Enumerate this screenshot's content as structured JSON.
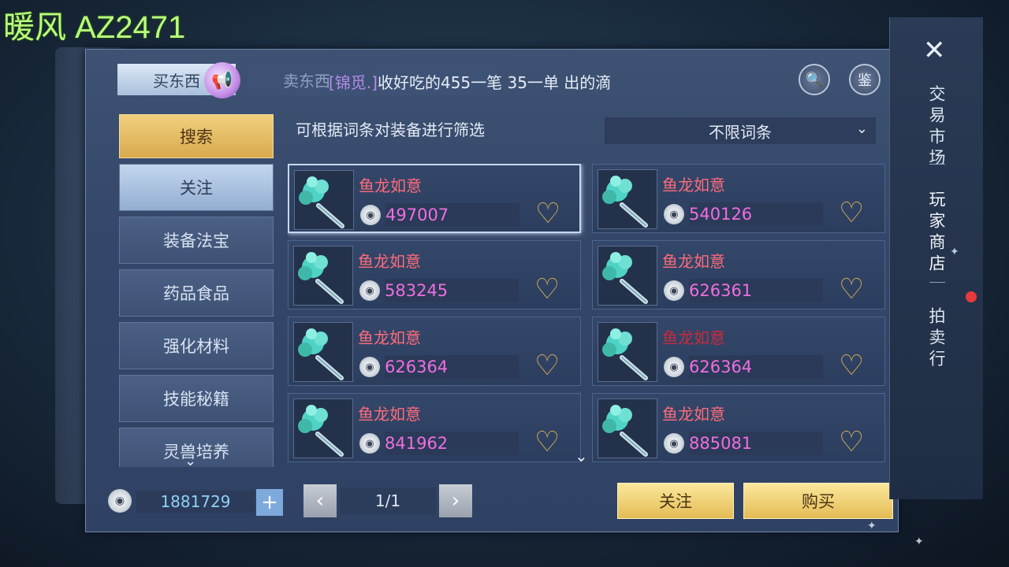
{
  "watermark": "暖风 AZ2471",
  "tabs": {
    "buy": "买东西",
    "sell": "卖东西"
  },
  "ticker": {
    "tag": "[锦觅.]",
    "message": "收好吃的455一笔  35一单 出的滴"
  },
  "header_buttons": {
    "search_icon": "magnifier-icon",
    "appraise_label": "鉴"
  },
  "sidebar": {
    "items": [
      {
        "label": "搜索",
        "state": "active"
      },
      {
        "label": "关注",
        "state": "follow"
      },
      {
        "label": "装备法宝",
        "state": "normal"
      },
      {
        "label": "药品食品",
        "state": "normal"
      },
      {
        "label": "强化材料",
        "state": "normal"
      },
      {
        "label": "技能秘籍",
        "state": "normal"
      },
      {
        "label": "灵兽培养",
        "state": "normal"
      }
    ]
  },
  "filter": {
    "label": "可根据词条对装备进行筛选",
    "dropdown_value": "不限词条"
  },
  "listings": [
    {
      "name": "鱼龙如意",
      "price": "497007",
      "selected": true
    },
    {
      "name": "鱼龙如意",
      "price": "540126",
      "selected": false
    },
    {
      "name": "鱼龙如意",
      "price": "583245",
      "selected": false
    },
    {
      "name": "鱼龙如意",
      "price": "626361",
      "selected": false
    },
    {
      "name": "鱼龙如意",
      "price": "626364",
      "selected": false
    },
    {
      "name": "鱼龙如意",
      "price": "626364",
      "selected": false
    },
    {
      "name": "鱼龙如意",
      "price": "841962",
      "selected": false
    },
    {
      "name": "鱼龙如意",
      "price": "885081",
      "selected": false
    }
  ],
  "wallet": {
    "balance": "1881729",
    "plus": "+"
  },
  "pager": {
    "prev": "‹",
    "page": "1/1",
    "next": "›"
  },
  "actions": {
    "follow": "关注",
    "buy": "购买"
  },
  "rail": {
    "close": "✕",
    "item1": "交易市场",
    "item2": "玩家商店",
    "item3": "拍卖行"
  },
  "colors": {
    "accent_gold": "#e4bc55",
    "name_red": "#ff6b7a",
    "price_pink": "#f06ee0",
    "notification": "#e53a3a"
  }
}
